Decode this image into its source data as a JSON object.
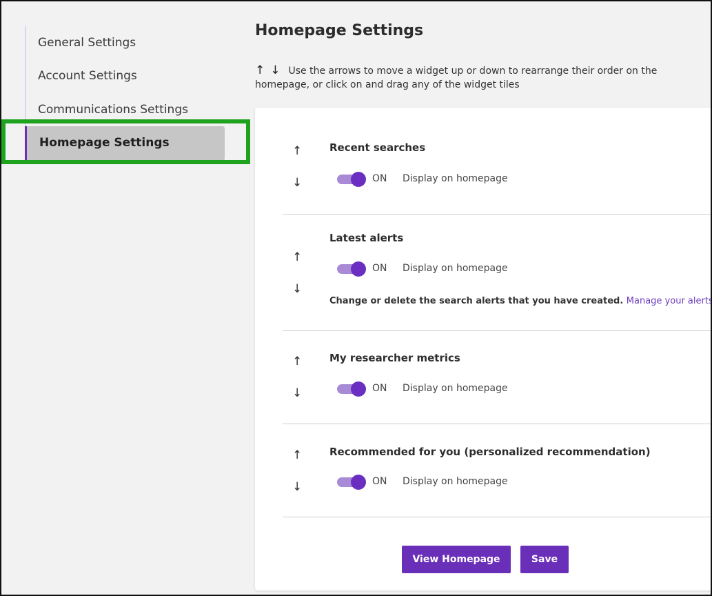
{
  "sidebar": {
    "items": [
      {
        "label": "General Settings"
      },
      {
        "label": "Account Settings"
      },
      {
        "label": "Communications Settings"
      },
      {
        "label": "Homepage Settings"
      }
    ]
  },
  "main": {
    "title": "Homepage Settings",
    "hint": {
      "up_arrow": "↑",
      "down_arrow": "↓",
      "text": "Use the arrows to move a widget up or down to rearrange their order on the homepage, or click on and drag any of the widget tiles"
    },
    "widgets": [
      {
        "title": "Recent searches",
        "toggle_state": "ON",
        "toggle_label": "Display on homepage",
        "enabled": true
      },
      {
        "title": "Latest alerts",
        "toggle_state": "ON",
        "toggle_label": "Display on homepage",
        "enabled": true,
        "note": "Change or delete the search alerts that you have created.",
        "note_link": "Manage your alerts"
      },
      {
        "title": "My researcher metrics",
        "toggle_state": "ON",
        "toggle_label": "Display on homepage",
        "enabled": true
      },
      {
        "title": "Recommended for you (personalized recommendation)",
        "toggle_state": "ON",
        "toggle_label": "Display on homepage",
        "enabled": true
      }
    ],
    "arrow_up": "↑",
    "arrow_down": "↓",
    "buttons": {
      "view_homepage": "View Homepage",
      "save": "Save"
    }
  },
  "colors": {
    "accent": "#6a2fb8",
    "toggle_track": "#a98ad6",
    "highlight": "#1fa31f",
    "active_bg": "#c6c6c6"
  }
}
